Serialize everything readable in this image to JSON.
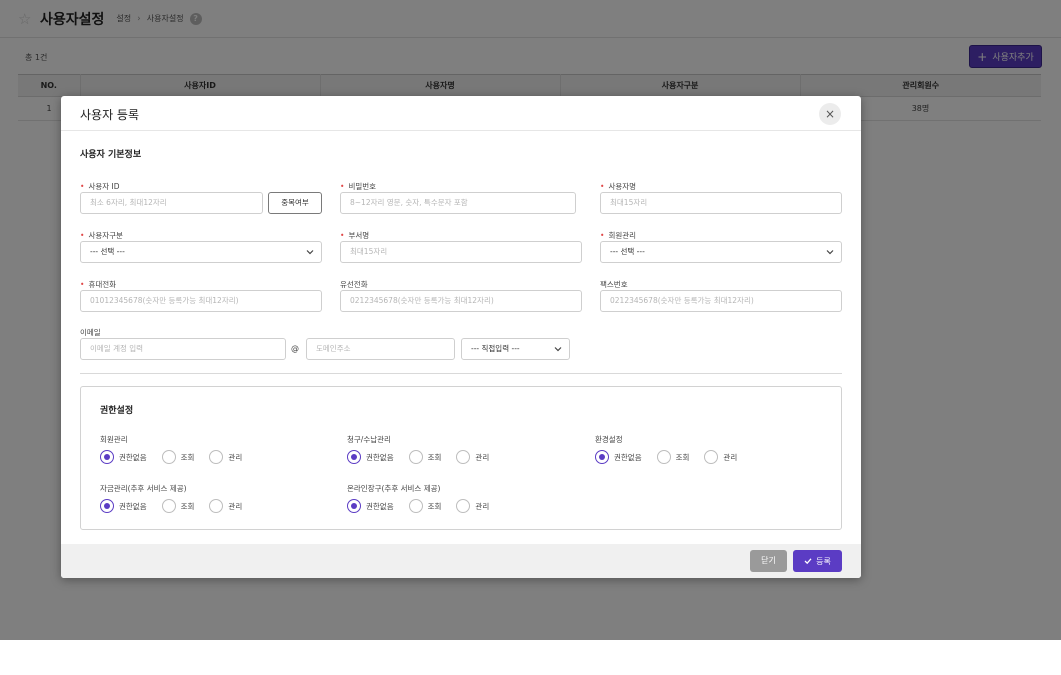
{
  "page": {
    "title": "사용자설정",
    "breadcrumb": [
      "설정",
      "사용자설정"
    ],
    "help": "?",
    "total": "총 1건",
    "add_button": "사용자추가"
  },
  "grid": {
    "columns": [
      "NO.",
      "사용자ID",
      "사용자명",
      "사용자구분",
      "관리회원수"
    ],
    "rows": [
      {
        "no": "1",
        "user_id": "",
        "user_name": "",
        "user_type": "",
        "members": "38명"
      }
    ]
  },
  "modal": {
    "title": "사용자 등록",
    "close": "×",
    "section_title": "사용자 기본정보",
    "fields": {
      "user_id": {
        "label": "사용자 ID",
        "placeholder": "최소 6자리, 최대12자리",
        "dup_button": "중복여부"
      },
      "password": {
        "label": "비밀번호",
        "placeholder": "8~12자리 영문, 숫자, 특수문자 포함"
      },
      "user_name": {
        "label": "사용자명",
        "placeholder": "최대15자리"
      },
      "user_type": {
        "label": "사용자구분",
        "value": "--- 선택 ---"
      },
      "department": {
        "label": "부서명",
        "placeholder": "최대15자리"
      },
      "member_mgmt": {
        "label": "회원관리",
        "value": "--- 선택 ---"
      },
      "mobile": {
        "label": "휴대전화",
        "placeholder": "01012345678(숫자만 등록가능 최대12자리)"
      },
      "landline": {
        "label": "유선전화",
        "placeholder": "0212345678(숫자만 등록가능 최대12자리)"
      },
      "fax": {
        "label": "팩스번호",
        "placeholder": "0212345678(숫자만 등록가능 최대12자리)"
      },
      "email": {
        "label": "이메일",
        "account_placeholder": "이메일 계정 입력",
        "at": "@",
        "domain_placeholder": "도메인주소",
        "domain_select": "--- 직접입력 ---"
      }
    },
    "permissions": {
      "title": "권한설정",
      "options": [
        "권한없음",
        "조회",
        "관리"
      ],
      "groups": [
        {
          "name": "회원관리",
          "selected": 0
        },
        {
          "name": "청구/수납관리",
          "selected": 0
        },
        {
          "name": "환경설정",
          "selected": 0
        },
        {
          "name": "자금관리(추후 서비스 제공)",
          "selected": 0
        },
        {
          "name": "온라인장구(추후 서비스 제공)",
          "selected": 0
        }
      ]
    },
    "footer": {
      "close": "닫기",
      "submit": "등록"
    }
  },
  "colors": {
    "accent": "#5b3cc4",
    "required": "#e04848",
    "overlay": "rgba(0,0,0,0.5)"
  }
}
